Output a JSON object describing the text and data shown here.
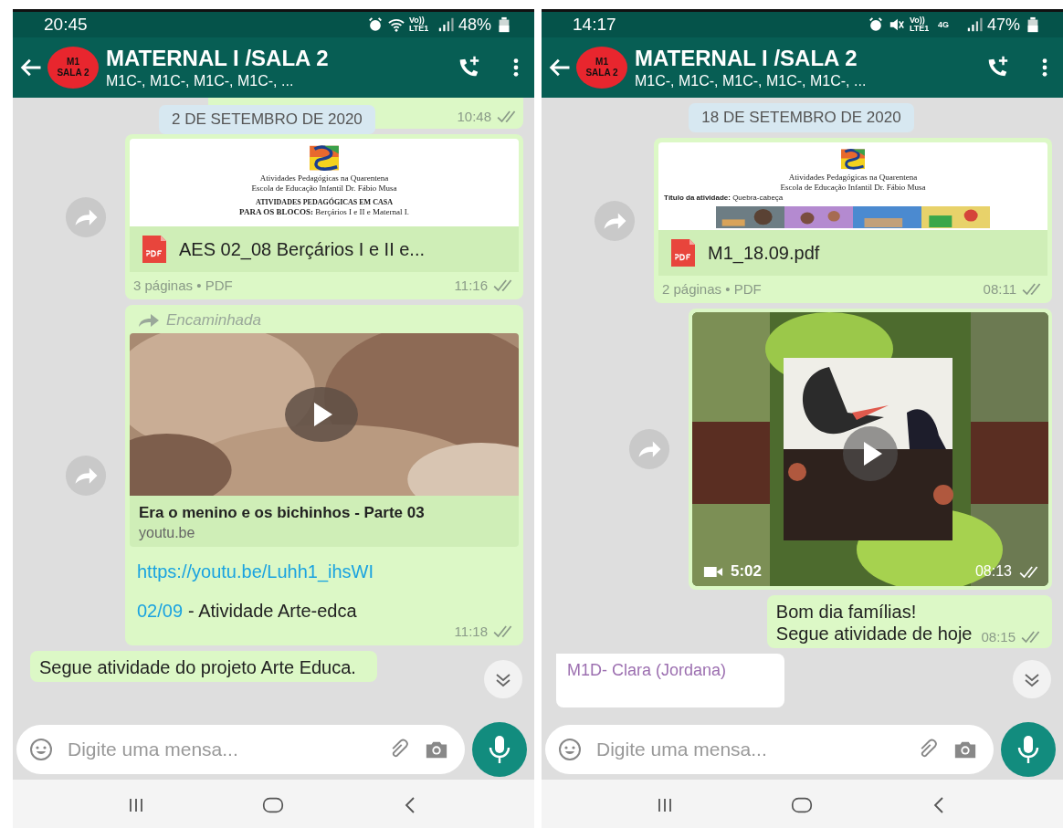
{
  "phones": [
    {
      "status": {
        "time": "20:45",
        "icons": [
          {
            "kind": "alarm"
          },
          {
            "kind": "wifi"
          }
        ],
        "indicators": [
          "Vo)) LTE1"
        ],
        "battery": "48%"
      },
      "header": {
        "avatar": [
          "M1",
          "SALA 2"
        ],
        "title": "MATERNAL I /SALA 2",
        "subtitle": "M1C-, M1C-, M1C-, M1C-, ..."
      },
      "messages": [
        {
          "kind": "stub",
          "date": "2 DE SETEMBRO DE 2020",
          "time": "10:48",
          "read": false
        },
        {
          "kind": "document",
          "forward": true,
          "preview": [
            {
              "kind": "logo"
            },
            {
              "kind": "line",
              "text": "Atividades Pedagógicas na Quarentena"
            },
            {
              "kind": "line",
              "text": "Escola de Educação Infantil Dr. Fábio Musa"
            },
            {
              "kind": "heading",
              "text": "ATIVIDADES PEDAGÓGICAS EM CASA"
            },
            {
              "kind": "line",
              "text": "**PARA OS BLOCOS:** Berçários I e II e Maternal I."
            }
          ],
          "file": "AES 02_08 Berçários I e II e...",
          "meta": "3 páginas • PDF",
          "time": "11:16",
          "read": false
        },
        {
          "kind": "link",
          "forward": true,
          "forwarded": "Encaminhada",
          "title": "Era o menino e os bichinhos - Parte 03",
          "domain": "youtu.be",
          "url": "https://youtu.be/Luhh1_ihsWI",
          "body_link": "02/09",
          "body_text": "- Atividade Arte-edca",
          "time": "11:18",
          "read": false
        },
        {
          "kind": "text",
          "text": "Segue atividade do projeto Arte Educa."
        }
      ],
      "input": {
        "placeholder": "Digite uma mensa..."
      }
    },
    {
      "status": {
        "time": "14:17",
        "icons": [
          {
            "kind": "alarm"
          },
          {
            "kind": "mute"
          }
        ],
        "indicators": [
          "Vo)) LTE1",
          "4G"
        ],
        "battery": "47%"
      },
      "header": {
        "avatar": [
          "M1",
          "SALA 2"
        ],
        "title": "MATERNAL I /SALA 2",
        "subtitle": "M1C-, M1C-, M1C-, M1C-, M1C-, ..."
      },
      "messages": [
        {
          "kind": "date",
          "text": "18 DE SETEMBRO DE 2020"
        },
        {
          "kind": "document",
          "forward": true,
          "preview": [
            {
              "kind": "logo"
            },
            {
              "kind": "line",
              "text": "Atividades Pedagógicas na Quarentena"
            },
            {
              "kind": "line",
              "text": "Escola de Educação Infantil Dr. Fábio Musa"
            },
            {
              "kind": "field",
              "text": "**Título da atividade:** Quebra-cabeça"
            },
            {
              "kind": "photos"
            }
          ],
          "file": "M1_18.09.pdf",
          "meta": "2 páginas • PDF",
          "time": "08:11",
          "read": false
        },
        {
          "kind": "video",
          "forward": true,
          "duration": "5:02",
          "time": "08:13",
          "read": false
        },
        {
          "kind": "text",
          "text": "Bom dia famílias!\nSegue atividade de hoje",
          "time": "08:15",
          "read": false
        },
        {
          "kind": "incoming",
          "sender": "M1D- Clara (Jordana)",
          "color": "#9c6fb0"
        }
      ],
      "input": {
        "placeholder": "Digite uma mensa..."
      }
    }
  ]
}
